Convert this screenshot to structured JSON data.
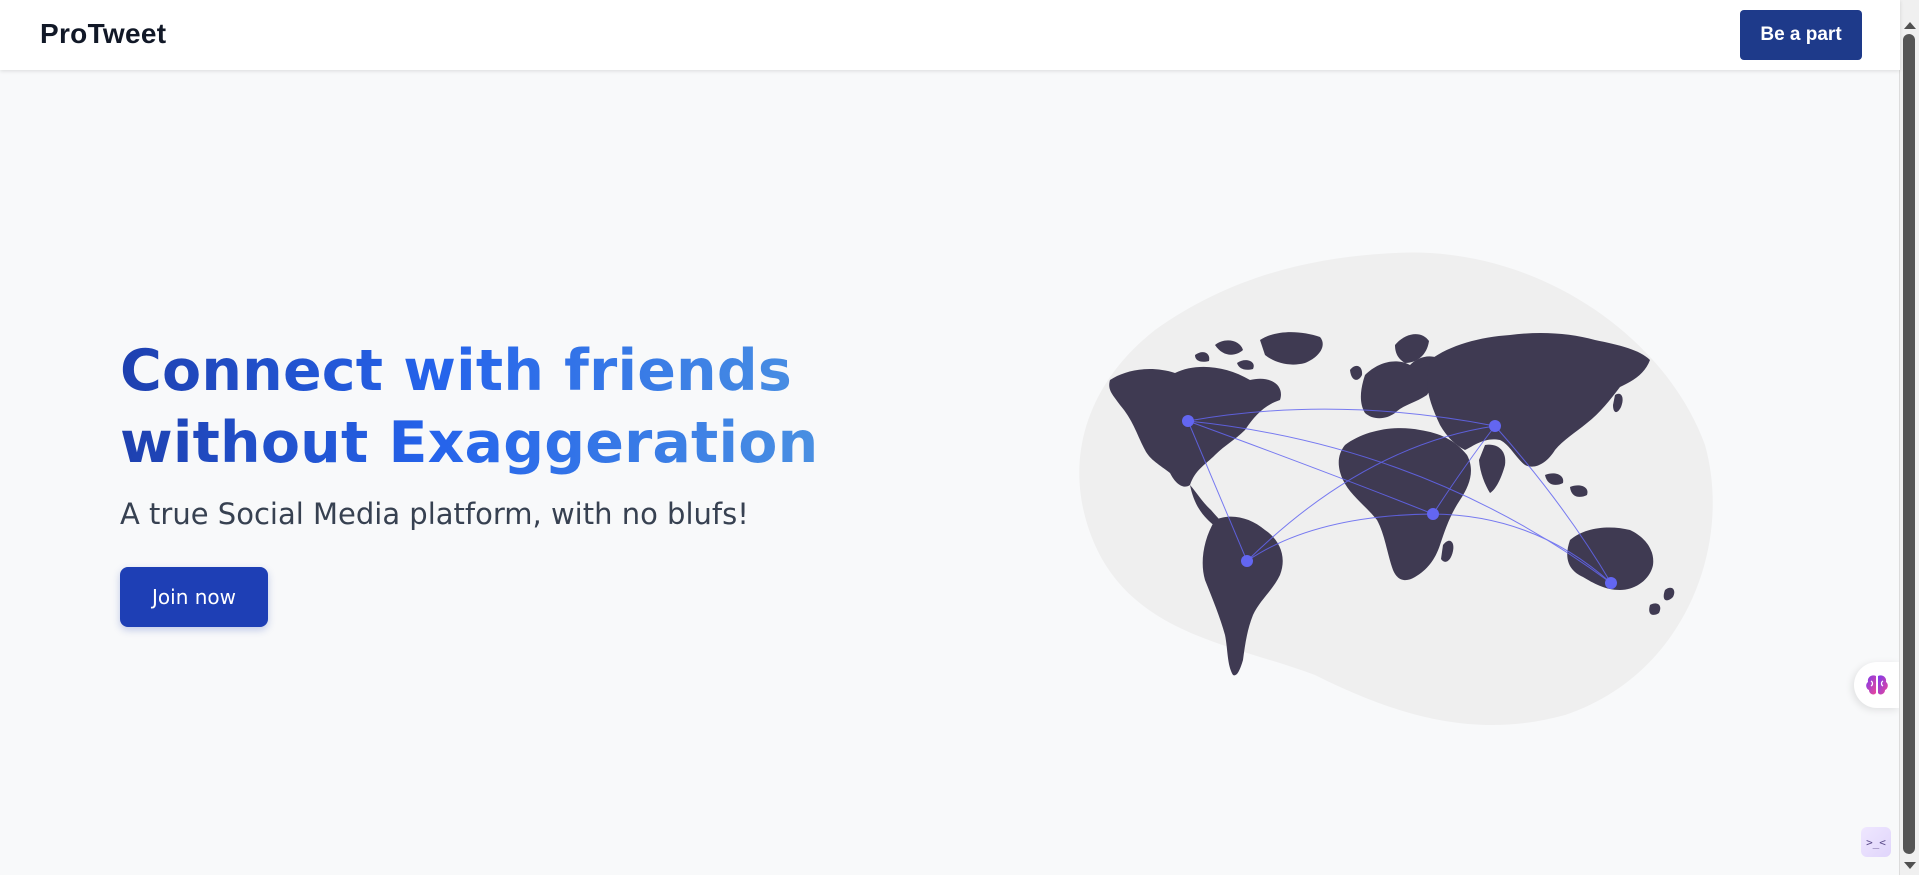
{
  "navbar": {
    "brand": "ProTweet",
    "cta_label": "Be a part"
  },
  "hero": {
    "headline_line1": "Connect with friends",
    "headline_line2": "without Exaggeration",
    "subline": "A true Social Media platform, with no blufs!",
    "join_label": "Join now"
  },
  "illustration": {
    "icon": "world-map-icon",
    "blob_color": "#efefef",
    "land_color": "#3f3a52",
    "node_color": "#6366f1"
  },
  "widgets": {
    "brain_icon": "brain-icon",
    "console_label": ">_<"
  },
  "colors": {
    "brand_dark": "#1e3a8a",
    "cta_blue": "#1e3fb5",
    "gradient_start": "#1e40af",
    "gradient_end": "#4a90e2"
  }
}
